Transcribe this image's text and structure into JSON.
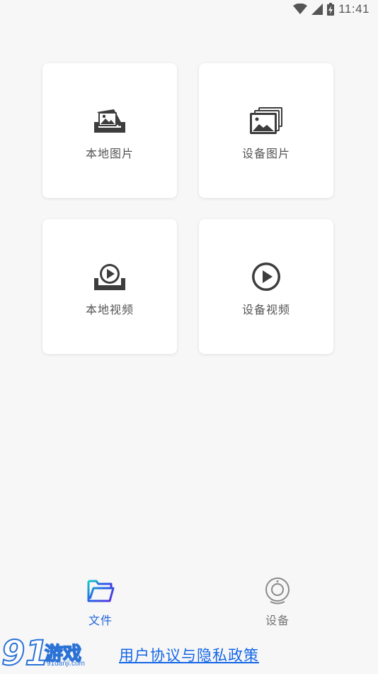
{
  "status_bar": {
    "time": "11:41",
    "icons": [
      "wifi-icon",
      "signal-icon",
      "battery-icon"
    ]
  },
  "cards": [
    {
      "label": "本地图片",
      "icon": "local-image-icon"
    },
    {
      "label": "设备图片",
      "icon": "device-image-icon"
    },
    {
      "label": "本地视频",
      "icon": "local-video-icon"
    },
    {
      "label": "设备视频",
      "icon": "device-video-icon"
    }
  ],
  "bottom_nav": {
    "items": [
      {
        "label": "文件",
        "icon": "folder-icon",
        "active": true
      },
      {
        "label": "设备",
        "icon": "camera-device-icon",
        "active": false
      }
    ]
  },
  "policy_link": "用户协议与隐私政策",
  "watermark": {
    "number": "91",
    "text": "游戏",
    "sub": "91danji.com"
  },
  "colors": {
    "accent": "#1e63d8",
    "link": "#1466e6",
    "background": "#f7f7f7",
    "card": "#ffffff",
    "icon": "#3d3d3d"
  }
}
